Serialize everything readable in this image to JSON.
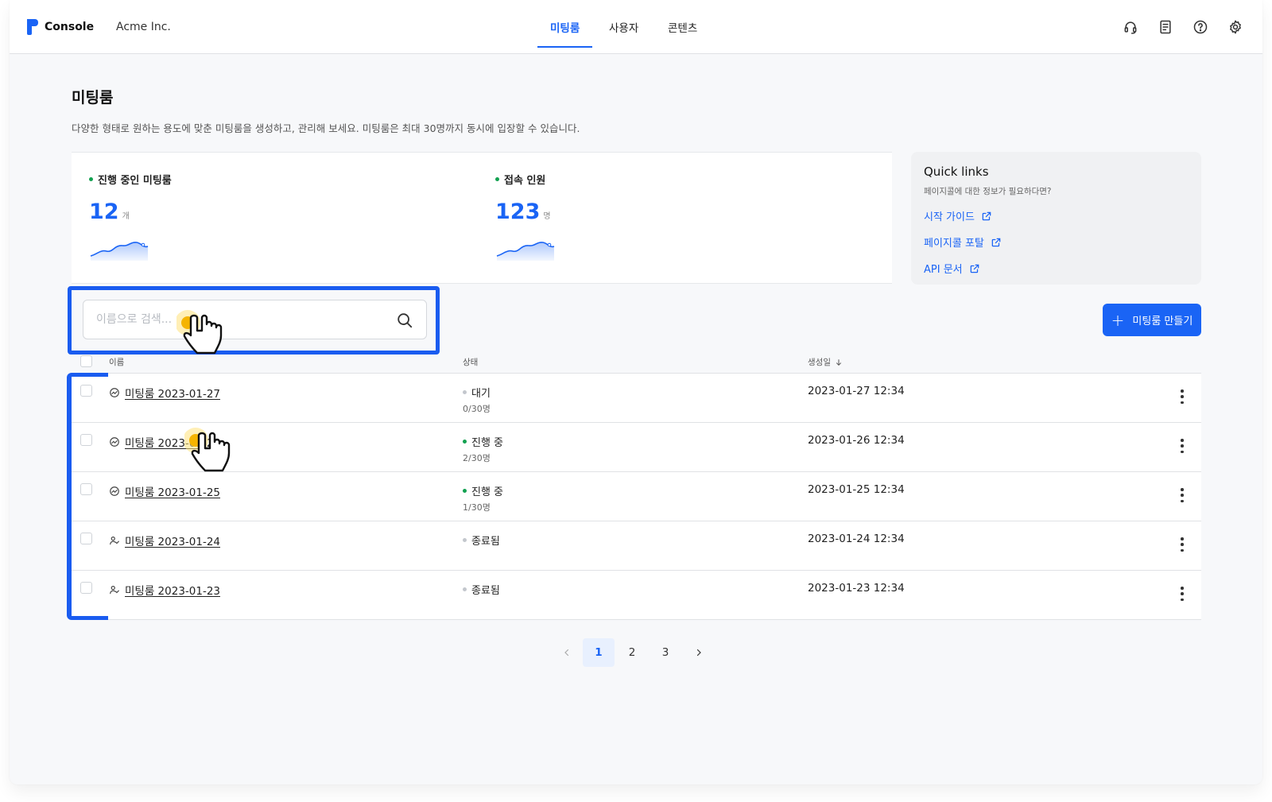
{
  "brand": {
    "name": "Console"
  },
  "org": {
    "name": "Acme Inc."
  },
  "nav": {
    "tabs": [
      {
        "label": "미팅룸",
        "active": true
      },
      {
        "label": "사용자"
      },
      {
        "label": "콘텐츠"
      }
    ]
  },
  "top_icons": [
    "headset-icon",
    "document-icon",
    "help-icon",
    "settings-icon"
  ],
  "page": {
    "title": "미팅룸",
    "description": "다양한 형태로 원하는 용도에 맞춘 미팅룸을 생성하고, 관리해 보세요. 미팅룸은 최대 30명까지 동시에 입장할 수 있습니다."
  },
  "stats": [
    {
      "label": "진행 중인 미팅룸",
      "value": "12",
      "unit": "개"
    },
    {
      "label": "접속 인원",
      "value": "123",
      "unit": "명"
    }
  ],
  "quick_links": {
    "title": "Quick links",
    "subtitle": "페이지콜에 대한 정보가 필요하다면?",
    "links": [
      "시작 가이드",
      "페이지콜 포탈",
      "API 문서"
    ]
  },
  "search": {
    "placeholder": "이름으로 검색..."
  },
  "create_button": {
    "label": "미팅룸 만들기"
  },
  "table": {
    "headers": {
      "name": "이름",
      "status": "상태",
      "created": "생성일"
    },
    "rows": [
      {
        "name": "미팅룸 2023-01-27",
        "status": "대기",
        "count": "0/30명",
        "date": "2023-01-27 12:34",
        "status_color": "#c3c7cd"
      },
      {
        "name": "미팅룸 2023-01-26",
        "status": "진행 중",
        "count": "2/30명",
        "date": "2023-01-26 12:34",
        "status_color": "#12a150"
      },
      {
        "name": "미팅룸 2023-01-25",
        "status": "진행 중",
        "count": "1/30명",
        "date": "2023-01-25 12:34",
        "status_color": "#12a150"
      },
      {
        "name": "미팅룸 2023-01-24",
        "status": "종료됨",
        "count": "",
        "date": "2023-01-24 12:34",
        "status_color": "#c3c7cd"
      },
      {
        "name": "미팅룸 2023-01-23",
        "status": "종료됨",
        "count": "",
        "date": "2023-01-23 12:34",
        "status_color": "#c3c7cd"
      }
    ]
  },
  "pagination": {
    "pages": [
      "1",
      "2",
      "3"
    ],
    "current": "1"
  },
  "colors": {
    "accent": "#1a64f5",
    "status_active": "#12a150",
    "status_idle": "#c3c7cd",
    "highlight": "#1a5cf0"
  }
}
